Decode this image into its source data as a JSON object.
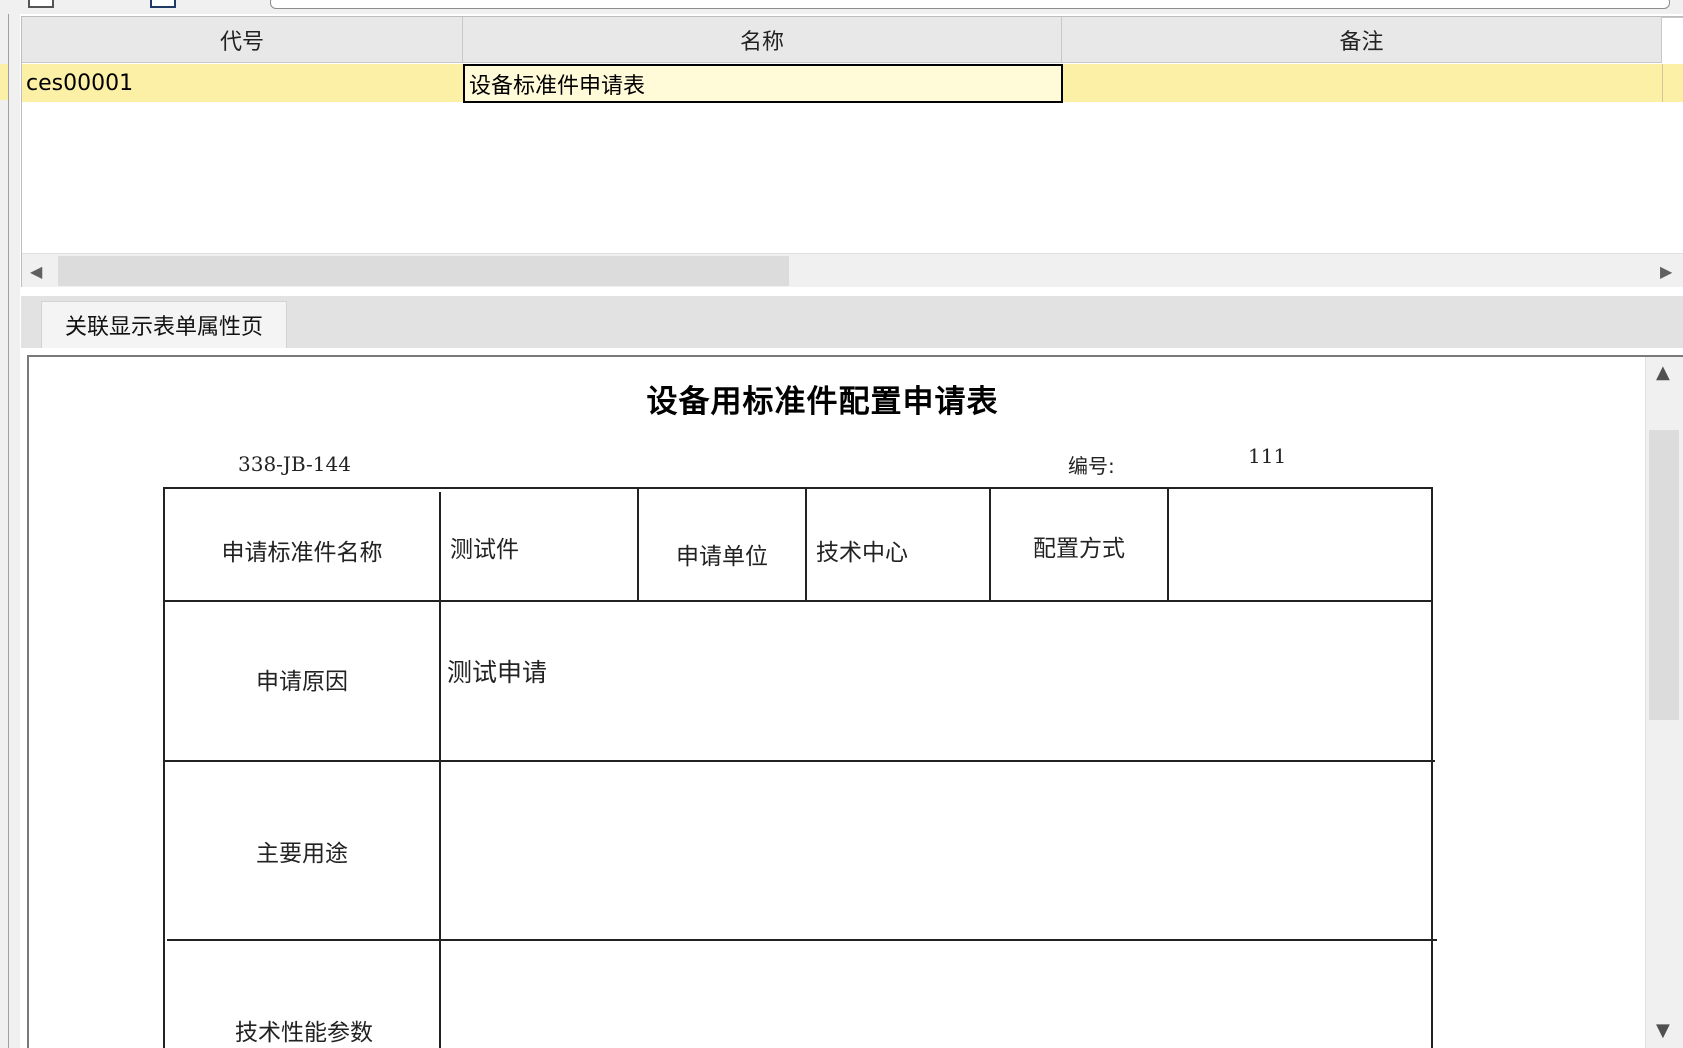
{
  "grid": {
    "columns": [
      "代号",
      "名称",
      "备注"
    ],
    "rows": [
      {
        "code": "ces00001",
        "name": "设备标准件申请表",
        "remark": ""
      }
    ]
  },
  "tab": {
    "label": "关联显示表单属性页"
  },
  "form": {
    "title": "设备用标准件配置申请表",
    "doc_code": "338-JB-144",
    "number_label": "编号:",
    "number_value": "111",
    "fields": {
      "std_part_name_label": "申请标准件名称",
      "std_part_name_value": "测试件",
      "applicant_unit_label": "申请单位",
      "applicant_unit_value": "技术中心",
      "config_method_label": "配置方式",
      "config_method_value": "",
      "reason_label": "申请原因",
      "reason_value": "测试申请",
      "usage_label": "主要用途",
      "usage_value": "",
      "tech_params_label": "技术性能参数",
      "tech_params_value": ""
    }
  },
  "icons": {
    "scroll_left": "◀",
    "scroll_right": "▶",
    "scroll_up": "▲",
    "scroll_down": "▼"
  },
  "colors": {
    "selected_row": "#fbf0a6",
    "header_bg": "#e8e8e8",
    "tab_band": "#e2e2e2"
  }
}
